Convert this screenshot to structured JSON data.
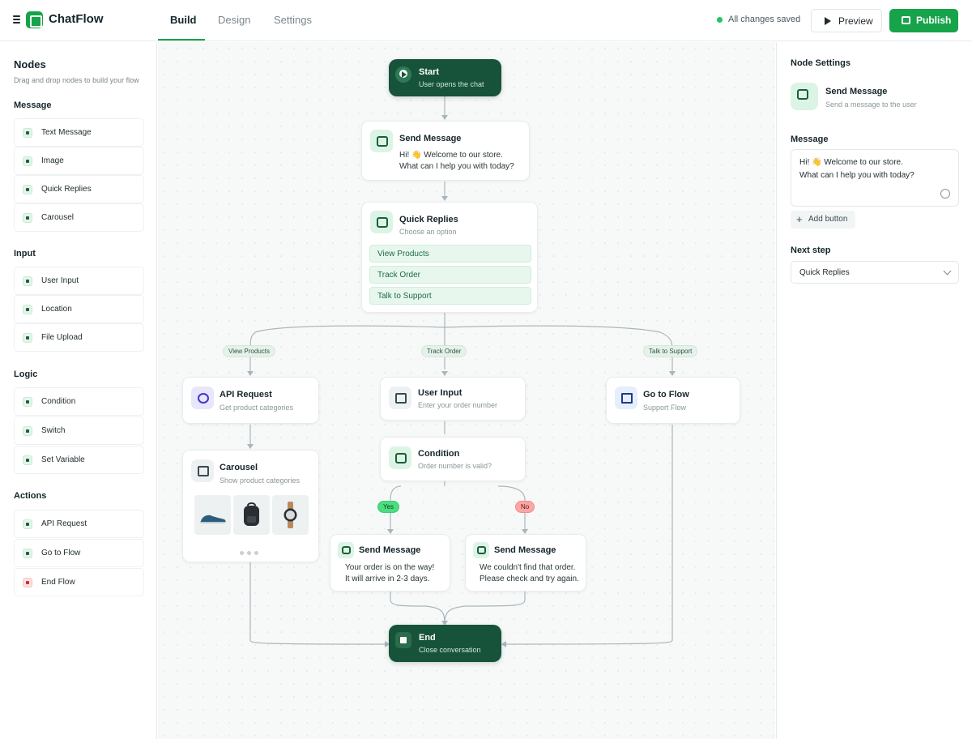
{
  "header": {
    "app_name": "ChatFlow",
    "tabs": [
      {
        "label": "Build"
      },
      {
        "label": "Design"
      },
      {
        "label": "Settings"
      }
    ],
    "status": "All changes saved",
    "preview_label": "Preview",
    "publish_label": "Publish"
  },
  "sidebar": {
    "title": "Nodes",
    "subtitle": "Drag and drop nodes to build your flow",
    "groups": [
      {
        "label": "Message",
        "items": [
          "Text Message",
          "Image",
          "Quick Replies",
          "Carousel"
        ]
      },
      {
        "label": "Input",
        "items": [
          "User Input",
          "Location",
          "File Upload"
        ]
      },
      {
        "label": "Logic",
        "items": [
          "Condition",
          "Switch",
          "Set Variable"
        ]
      },
      {
        "label": "Actions",
        "items": [
          "API Request",
          "Go to Flow",
          "End Flow"
        ]
      }
    ]
  },
  "canvas": {
    "start": {
      "title": "Start",
      "subtitle": "User opens the chat"
    },
    "send_message": {
      "title": "Send Message",
      "line1": "Hi! 👋 Welcome to our store.",
      "line2": "What can I help you with today?"
    },
    "quick_replies": {
      "title": "Quick Replies",
      "subtitle": "Choose an option",
      "options": [
        "View Products",
        "Track Order",
        "Talk to Support"
      ]
    },
    "branch_labels": [
      "View Products",
      "Track Order",
      "Talk to Support"
    ],
    "api_request": {
      "title": "API Request",
      "subtitle": "Get product categories"
    },
    "user_input": {
      "title": "User Input",
      "subtitle": "Enter your order number"
    },
    "go_to_flow": {
      "title": "Go to Flow",
      "subtitle": "Support Flow"
    },
    "carousel": {
      "title": "Carousel",
      "subtitle": "Show product categories",
      "thumbnails": [
        "shoe-image",
        "backpack-image",
        "watch-image"
      ]
    },
    "condition": {
      "title": "Condition",
      "subtitle": "Order number is valid?",
      "yes_label": "Yes",
      "no_label": "No"
    },
    "send_yes": {
      "title": "Send Message",
      "line1": "Your order is on the way!",
      "line2": "It will arrive in 2-3 days."
    },
    "send_no": {
      "title": "Send Message",
      "line1": "We couldn't find that order.",
      "line2": "Please check and try again."
    },
    "end": {
      "title": "End",
      "subtitle": "Close conversation"
    }
  },
  "settings": {
    "title": "Node Settings",
    "node_title": "Send Message",
    "node_subtitle": "Send a message to the user",
    "message_label": "Message",
    "message_line1": "Hi! 👋 Welcome to our store.",
    "message_line2": "What can I help you with today?",
    "add_button_label": "Add button",
    "next_step_label": "Next step",
    "next_step_value": "Quick Replies"
  },
  "colors": {
    "accent": "#16a34a",
    "dark_node": "#17533a",
    "yes": "#4ade80",
    "no": "#fca5a5"
  }
}
